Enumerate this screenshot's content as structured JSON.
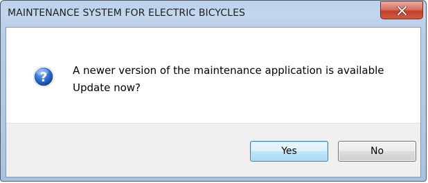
{
  "window": {
    "title": "MAINTENANCE SYSTEM FOR ELECTRIC BICYCLES",
    "close_icon": "close-icon"
  },
  "message": {
    "icon": "question-icon",
    "line1": "A newer version of the maintenance application is available",
    "line2": "Update now?"
  },
  "buttons": {
    "yes_label": "Yes",
    "no_label": "No"
  },
  "colors": {
    "titlebar": "#bcd3ec",
    "close_button": "#c8442d",
    "question_icon": "#1f5eb8",
    "default_button_border": "#3c7fb1",
    "button_area": "#f0f0f0"
  }
}
